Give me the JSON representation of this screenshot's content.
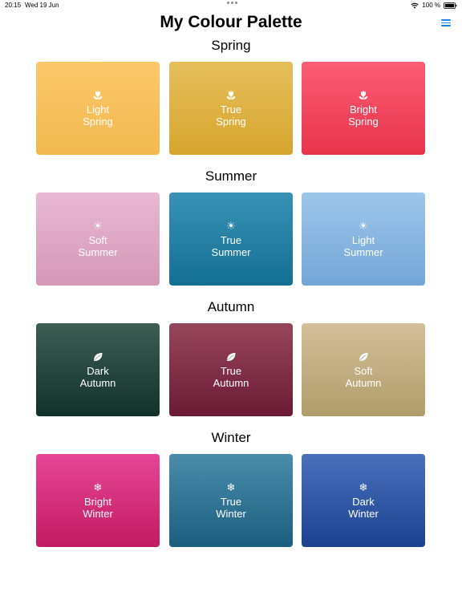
{
  "status_bar": {
    "time": "20:15",
    "date": "Wed 19 Jun",
    "battery": "100 %"
  },
  "title": "My Colour Palette",
  "sections": [
    {
      "title": "Spring",
      "cards": [
        {
          "label": "Light\nSpring",
          "icon": "tulip-icon",
          "glyph": "",
          "top": "#fcc86b",
          "bottom": "#f1b84e"
        },
        {
          "label": "True\nSpring",
          "icon": "tulip-icon",
          "glyph": "",
          "top": "#e6bf5c",
          "bottom": "#d6a52e"
        },
        {
          "label": "Bright\nSpring",
          "icon": "tulip-icon",
          "glyph": "",
          "top": "#fb5d74",
          "bottom": "#e7344b"
        }
      ]
    },
    {
      "title": "Summer",
      "cards": [
        {
          "label": "Soft\nSummer",
          "icon": "sun-icon",
          "glyph": "☀",
          "top": "#e8b8d3",
          "bottom": "#d598b6"
        },
        {
          "label": "True\nSummer",
          "icon": "sun-icon",
          "glyph": "☀",
          "top": "#3992b5",
          "bottom": "#136f92"
        },
        {
          "label": "Light\nSummer",
          "icon": "sun-icon",
          "glyph": "☀",
          "top": "#9ec6ea",
          "bottom": "#73a6d8"
        }
      ]
    },
    {
      "title": "Autumn",
      "cards": [
        {
          "label": "Dark\nAutumn",
          "icon": "leaf-icon",
          "glyph": "",
          "top": "#3d5e53",
          "bottom": "#11312a"
        },
        {
          "label": "True\nAutumn",
          "icon": "leaf-icon",
          "glyph": "",
          "top": "#97465b",
          "bottom": "#6a1a34"
        },
        {
          "label": "Soft\nAutumn",
          "icon": "leaf-icon",
          "glyph": "",
          "top": "#d3c09a",
          "bottom": "#b09c69"
        }
      ]
    },
    {
      "title": "Winter",
      "cards": [
        {
          "label": "Bright\nWinter",
          "icon": "snowflake-icon",
          "glyph": "❄",
          "top": "#e64696",
          "bottom": "#c21a62"
        },
        {
          "label": "True\nWinter",
          "icon": "snowflake-icon",
          "glyph": "❄",
          "top": "#4a8caa",
          "bottom": "#1b5e7f"
        },
        {
          "label": "Dark\nWinter",
          "icon": "snowflake-icon",
          "glyph": "❄",
          "top": "#4a70bc",
          "bottom": "#1a4290"
        }
      ]
    }
  ]
}
